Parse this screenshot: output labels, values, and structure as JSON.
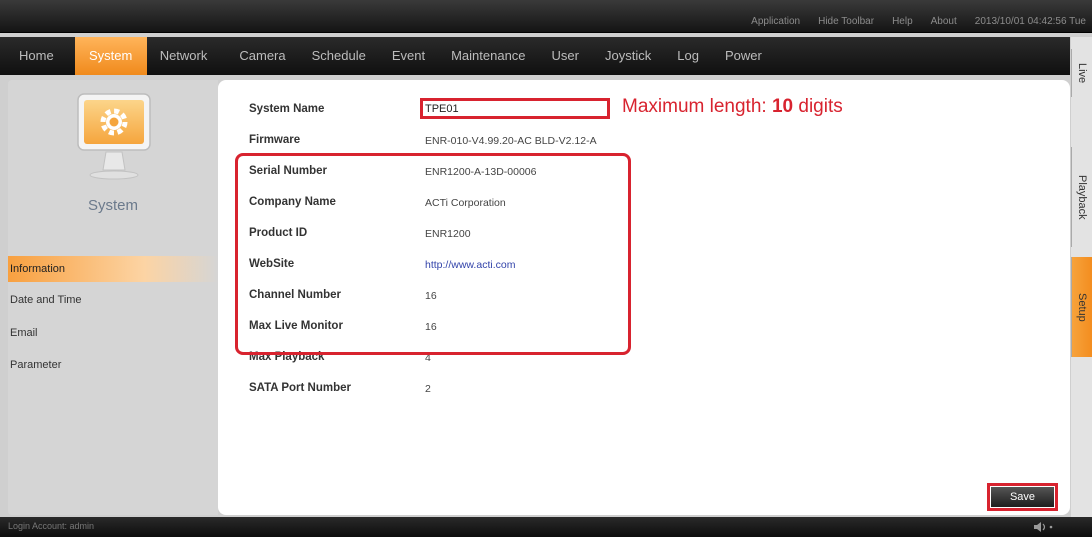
{
  "toolbar": {
    "links": [
      "Application",
      "Hide Toolbar",
      "Help",
      "About"
    ],
    "clock": "2013/10/01 04:42:56 Tue"
  },
  "nav": {
    "items": [
      "Home",
      "System",
      "Network",
      "Camera",
      "Schedule",
      "Event",
      "Maintenance",
      "User",
      "Joystick",
      "Log",
      "Power"
    ],
    "active": "System"
  },
  "side_tabs": {
    "live": "Live",
    "playback": "Playback",
    "setup": "Setup"
  },
  "sidebar": {
    "icon": "monitor-gear-icon",
    "title": "System",
    "items": [
      {
        "label": "Information",
        "active": true
      },
      {
        "label": "Date and Time",
        "active": false
      },
      {
        "label": "Email",
        "active": false
      },
      {
        "label": "Parameter",
        "active": false
      }
    ]
  },
  "form": {
    "system_name": {
      "label": "System Name",
      "value": "TPE01"
    },
    "max_length_note": {
      "prefix": "Maximum length: ",
      "number": "10",
      "suffix": " digits"
    },
    "fields": [
      {
        "label": "Firmware",
        "value": "ENR-010-V4.99.20-AC BLD-V2.12-A"
      },
      {
        "label": "Serial Number",
        "value": "ENR1200-A-13D-00006"
      },
      {
        "label": "Company Name",
        "value": "ACTi Corporation"
      },
      {
        "label": "Product ID",
        "value": "ENR1200"
      },
      {
        "label": "WebSite",
        "value": "http://www.acti.com"
      },
      {
        "label": "Channel Number",
        "value": "16"
      },
      {
        "label": "Max Live Monitor",
        "value": "16"
      },
      {
        "label": "Max Playback",
        "value": "4"
      },
      {
        "label": "SATA Port Number",
        "value": "2"
      }
    ],
    "save_label": "Save"
  },
  "status": {
    "login": "Login Account: admin",
    "volume_icon": "speaker-icon"
  },
  "colors": {
    "accent": "#f39020",
    "highlight": "#d8232f",
    "link": "#3344aa"
  }
}
